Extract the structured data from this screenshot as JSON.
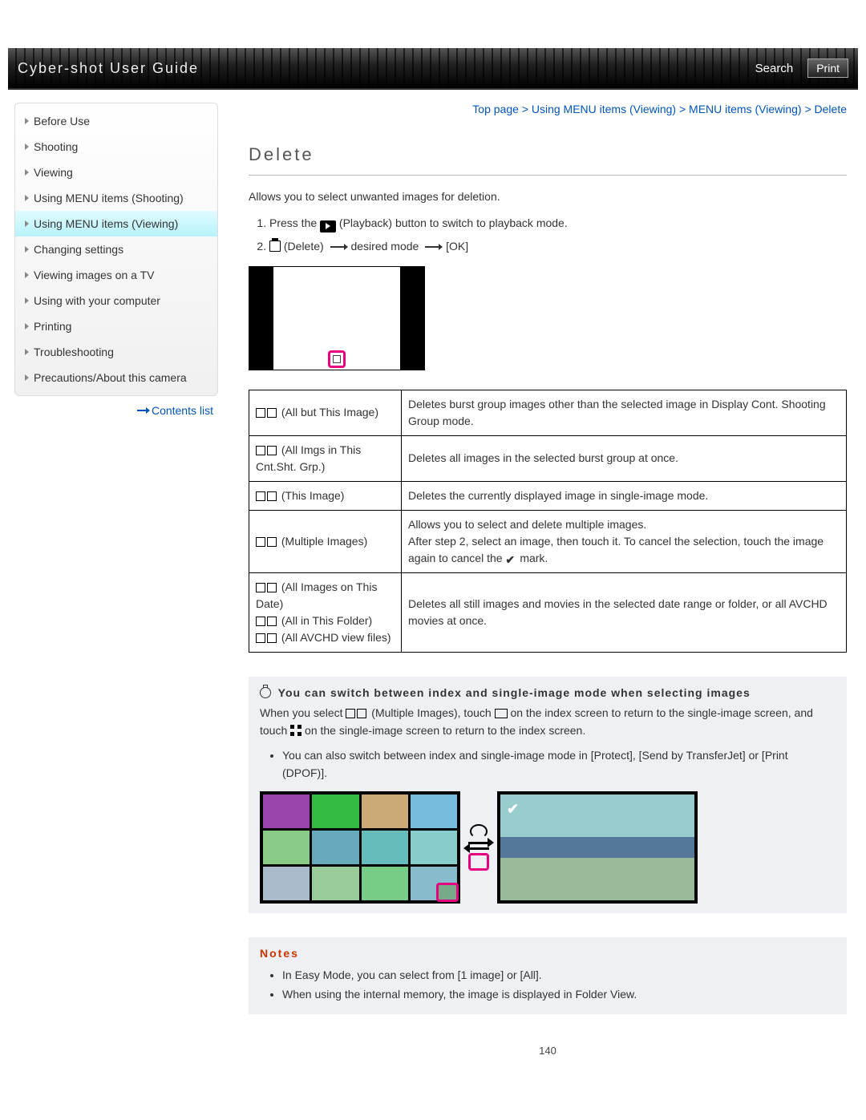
{
  "header": {
    "title": "Cyber-shot User Guide",
    "search_label": "Search",
    "print_label": "Print"
  },
  "sidebar": {
    "items": [
      {
        "label": "Before Use"
      },
      {
        "label": "Shooting"
      },
      {
        "label": "Viewing"
      },
      {
        "label": "Using MENU items (Shooting)"
      },
      {
        "label": "Using MENU items (Viewing)",
        "active": true
      },
      {
        "label": "Changing settings"
      },
      {
        "label": "Viewing images on a TV"
      },
      {
        "label": "Using with your computer"
      },
      {
        "label": "Printing"
      },
      {
        "label": "Troubleshooting"
      },
      {
        "label": "Precautions/About this camera"
      }
    ],
    "contents_list_label": "Contents list"
  },
  "breadcrumb": "Top page > Using MENU items (Viewing) > MENU items (Viewing) > Delete",
  "page_title": "Delete",
  "intro": "Allows you to select unwanted images for deletion.",
  "steps": {
    "s1a": "Press the ",
    "s1b": " (Playback) button to switch to playback mode.",
    "s2a": " (Delete) ",
    "s2b": " desired mode ",
    "s2c": " [OK]"
  },
  "table": {
    "r1": {
      "opt": " (All but This Image)",
      "desc": "Deletes burst group images other than the selected image in Display Cont. Shooting Group mode."
    },
    "r2": {
      "opt": " (All Imgs in This Cnt.Sht. Grp.)",
      "desc": "Deletes all images in the selected burst group at once."
    },
    "r3": {
      "opt": " (This Image)",
      "desc": "Deletes the currently displayed image in single-image mode."
    },
    "r4": {
      "opt": " (Multiple Images)",
      "desc_a": "Allows you to select and delete multiple images.",
      "desc_b": "After step 2, select an image, then touch it. To cancel the selection, touch the image again to cancel the ",
      "desc_c": " mark."
    },
    "r5": {
      "opt_a": " (All Images on This Date)",
      "opt_b": " (All in This Folder)",
      "opt_c": " (All AVCHD view files)",
      "desc": "Deletes all still images and movies in the selected date range or folder, or all AVCHD movies at once."
    }
  },
  "tip": {
    "heading": "You can switch between index and single-image mode when selecting images",
    "line1a": "When you select ",
    "line1b": " (Multiple Images), touch ",
    "line1c": " on the index screen to return to the single-image screen, and touch ",
    "line1d": " on the single-image screen to return to the index screen.",
    "bullet1": "You can also switch between index and single-image mode in [Protect], [Send by TransferJet] or [Print (DPOF)]."
  },
  "notes": {
    "heading": "Notes",
    "n1": "In Easy Mode, you can select from [1 image] or [All].",
    "n2": "When using the internal memory, the image is displayed in Folder View."
  },
  "page_number": "140"
}
